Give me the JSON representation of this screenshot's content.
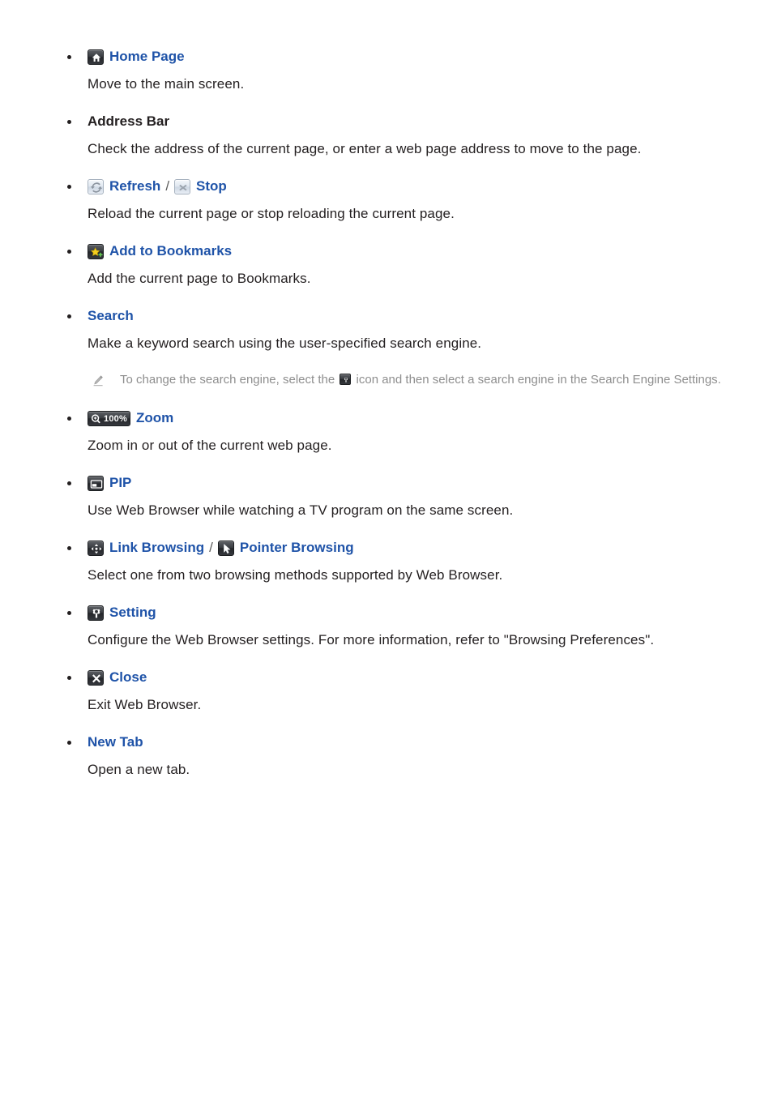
{
  "document": {
    "type": "manual-page",
    "topic": "Web Browser toolbar features",
    "link_color": "#1f53a8",
    "text_color": "#231f20",
    "note_color": "#8e8e8e"
  },
  "separator": "/",
  "items": [
    {
      "id": "home-page",
      "terms": [
        {
          "label": "Home Page",
          "icon": "home-icon",
          "icon_style": "dark"
        }
      ],
      "style": "link",
      "description": "Move to the main screen."
    },
    {
      "id": "address-bar",
      "terms": [
        {
          "label": "Address Bar",
          "icon": null,
          "icon_style": null
        }
      ],
      "style": "plain",
      "description": "Check the address of the current page, or enter a web page address to move to the page."
    },
    {
      "id": "refresh-stop",
      "terms": [
        {
          "label": "Refresh",
          "icon": "refresh-icon",
          "icon_style": "light"
        },
        {
          "label": "Stop",
          "icon": "stop-icon",
          "icon_style": "light"
        }
      ],
      "style": "link",
      "description": "Reload the current page or stop reloading the current page."
    },
    {
      "id": "add-to-bookmarks",
      "terms": [
        {
          "label": "Add to Bookmarks",
          "icon": "add-bookmark-star-icon",
          "icon_style": "dark"
        }
      ],
      "style": "link",
      "description": "Add the current page to Bookmarks."
    },
    {
      "id": "search",
      "terms": [
        {
          "label": "Search",
          "icon": null,
          "icon_style": null
        }
      ],
      "style": "link",
      "description": "Make a keyword search using the user-specified search engine.",
      "note": {
        "icon": "pencil-note-icon",
        "text_before": "To change the search engine, select the",
        "inline_icon": "gear-icon",
        "text_after": "icon and then select a search engine in the Search Engine Settings."
      }
    },
    {
      "id": "zoom",
      "terms": [
        {
          "label": "Zoom",
          "icon": "zoom-100-badge-icon",
          "icon_style": "dark",
          "icon_text": "100%"
        }
      ],
      "style": "link",
      "description": "Zoom in or out of the current web page."
    },
    {
      "id": "pip",
      "terms": [
        {
          "label": "PIP",
          "icon": "pip-icon",
          "icon_style": "dark"
        }
      ],
      "style": "link",
      "description": "Use Web Browser while watching a TV program on the same screen."
    },
    {
      "id": "browsing-methods",
      "terms": [
        {
          "label": "Link Browsing",
          "icon": "four-way-arrow-icon",
          "icon_style": "dark"
        },
        {
          "label": "Pointer Browsing",
          "icon": "mouse-pointer-icon",
          "icon_style": "dark"
        }
      ],
      "style": "link",
      "description": "Select one from two browsing methods supported by Web Browser."
    },
    {
      "id": "setting",
      "terms": [
        {
          "label": "Setting",
          "icon": "gear-icon",
          "icon_style": "dark"
        }
      ],
      "style": "link",
      "description": "Configure the Web Browser settings. For more information, refer to \"Browsing Preferences\"."
    },
    {
      "id": "close",
      "terms": [
        {
          "label": "Close",
          "icon": "close-x-icon",
          "icon_style": "dark"
        }
      ],
      "style": "link",
      "description": "Exit Web Browser."
    },
    {
      "id": "new-tab",
      "terms": [
        {
          "label": "New Tab",
          "icon": null,
          "icon_style": null
        }
      ],
      "style": "link",
      "description": "Open a new tab."
    }
  ]
}
